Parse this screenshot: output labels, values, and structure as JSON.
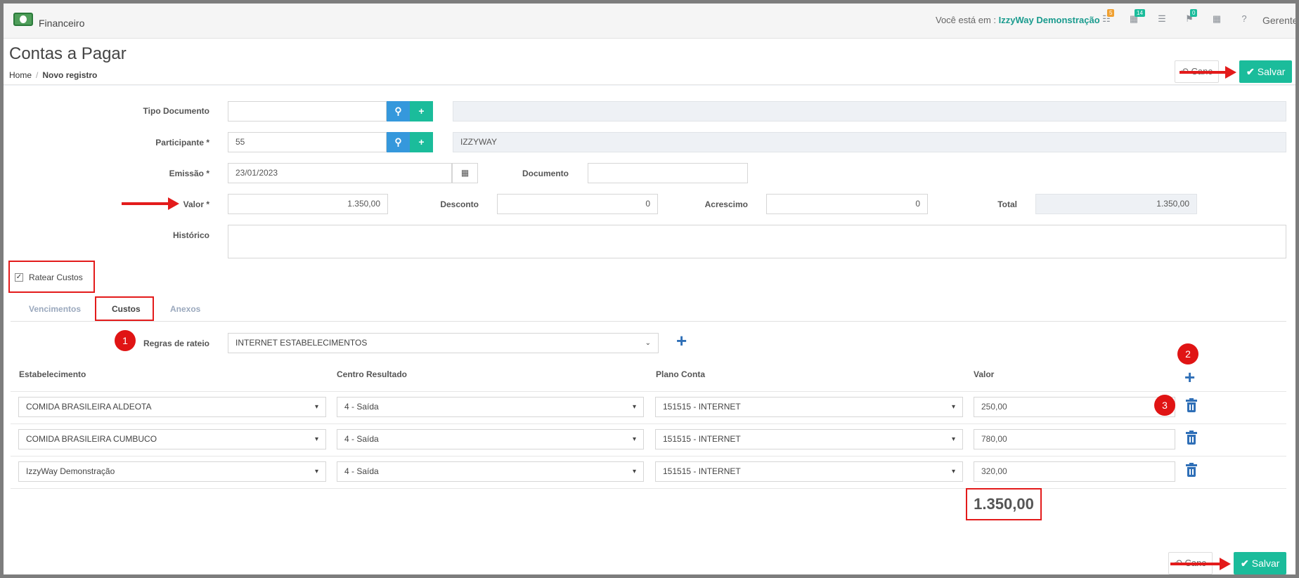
{
  "app": {
    "title": "Financeiro"
  },
  "topbar": {
    "context_label": "Você está em :",
    "context_value": "IzzyWay Demonstração",
    "badges": {
      "sitemap": "5",
      "grid": "14",
      "bell": "0"
    },
    "user": "Gerente"
  },
  "page": {
    "title": "Contas a Pagar",
    "breadcrumb": [
      "Home",
      "Novo registro"
    ]
  },
  "buttons": {
    "cancel": "Canc",
    "save": "Salvar"
  },
  "form": {
    "tipo_documento": {
      "label": "Tipo Documento",
      "value": "",
      "description": ""
    },
    "participante": {
      "label": "Participante *",
      "value": "55",
      "description": "IZZYWAY"
    },
    "emissao": {
      "label": "Emissão *",
      "value": "23/01/2023"
    },
    "documento": {
      "label": "Documento",
      "value": ""
    },
    "valor": {
      "label": "Valor *",
      "value": "1.350,00"
    },
    "desconto": {
      "label": "Desconto",
      "value": "0"
    },
    "acrescimo": {
      "label": "Acrescimo",
      "value": "0"
    },
    "total": {
      "label": "Total",
      "value": "1.350,00"
    },
    "historico": {
      "label": "Histórico",
      "value": ""
    }
  },
  "ratear": {
    "label": "Ratear Custos",
    "checked": true
  },
  "tabs": [
    "Vencimentos",
    "Custos",
    "Anexos"
  ],
  "active_tab": "Custos",
  "regras": {
    "label": "Regras de rateio",
    "value": "INTERNET ESTABELECIMENTOS"
  },
  "callouts": [
    "1",
    "2",
    "3"
  ],
  "table": {
    "headers": [
      "Estabelecimento",
      "Centro Resultado",
      "Plano Conta",
      "Valor"
    ],
    "rows": [
      {
        "estabelecimento": "COMIDA BRASILEIRA ALDEOTA",
        "centro": "4 - Saída",
        "plano": "151515 - INTERNET",
        "valor": "250,00"
      },
      {
        "estabelecimento": "COMIDA BRASILEIRA CUMBUCO",
        "centro": "4 - Saída",
        "plano": "151515 - INTERNET",
        "valor": "780,00"
      },
      {
        "estabelecimento": "IzzyWay Demonstração",
        "centro": "4 - Saída",
        "plano": "151515 - INTERNET",
        "valor": "320,00"
      }
    ],
    "total": "1.350,00"
  },
  "colors": {
    "accent": "#1bbc9b",
    "primary": "#3598dc",
    "highlight": "#e31b1b"
  }
}
